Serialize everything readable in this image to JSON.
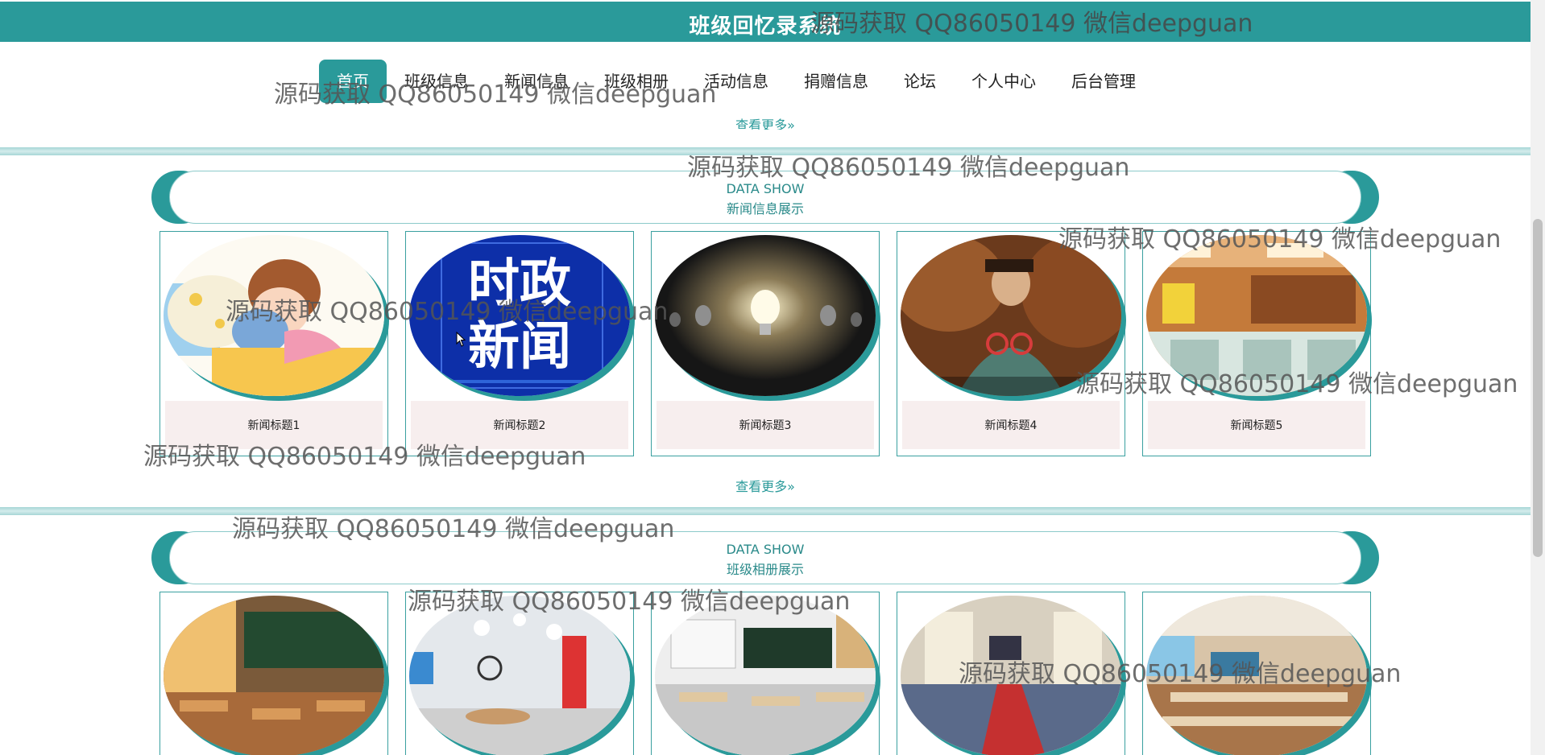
{
  "header": {
    "title": "班级回忆录系统"
  },
  "nav": {
    "items": [
      {
        "label": "首页",
        "active": true
      },
      {
        "label": "班级信息"
      },
      {
        "label": "新闻信息"
      },
      {
        "label": "班级相册"
      },
      {
        "label": "活动信息"
      },
      {
        "label": "捐赠信息"
      },
      {
        "label": "论坛"
      },
      {
        "label": "个人中心"
      },
      {
        "label": "后台管理"
      }
    ]
  },
  "more_label": "查看更多",
  "news_section": {
    "label_en": "DATA SHOW",
    "label_zh": "新闻信息展示",
    "items": [
      {
        "title": "新闻标题1",
        "image": "cartoon-girl-sleeping"
      },
      {
        "title": "新闻标题2",
        "image": "politics-news-graphic",
        "overlay_line1": "时政",
        "overlay_line2": "新闻"
      },
      {
        "title": "新闻标题3",
        "image": "light-bulbs"
      },
      {
        "title": "新闻标题4",
        "image": "movie-still"
      },
      {
        "title": "新闻标题5",
        "image": "restaurant-interior"
      }
    ]
  },
  "album_section": {
    "label_en": "DATA SHOW",
    "label_zh": "班级相册展示",
    "items": [
      {
        "image": "classroom-anime"
      },
      {
        "image": "modern-classroom"
      },
      {
        "image": "classroom-blackboard"
      },
      {
        "image": "meeting-room-red-carpet"
      },
      {
        "image": "lecture-hall"
      }
    ]
  },
  "watermark": {
    "text": "源码获取 QQ86050149 微信deepguan"
  },
  "colors": {
    "accent": "#2a9a9a",
    "caption_bg": "#f7eeee"
  }
}
